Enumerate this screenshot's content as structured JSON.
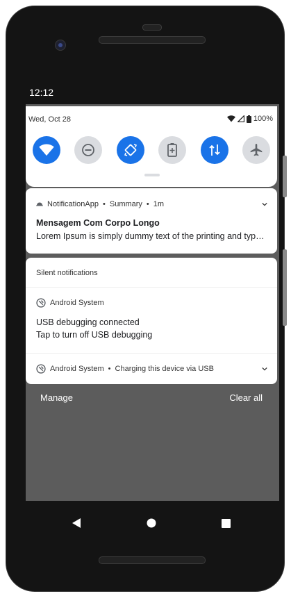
{
  "status_bar": {
    "time": "12:12"
  },
  "quick_settings": {
    "date": "Wed, Oct 28",
    "battery": "100%",
    "tiles": [
      {
        "name": "wifi",
        "icon": "wifi-icon",
        "state": "on"
      },
      {
        "name": "do-not-disturb",
        "icon": "do-not-disturb-icon",
        "state": "off"
      },
      {
        "name": "auto-rotate",
        "icon": "auto-rotate-icon",
        "state": "on"
      },
      {
        "name": "battery-saver",
        "icon": "battery-saver-icon",
        "state": "off"
      },
      {
        "name": "mobile-data",
        "icon": "mobile-data-icon",
        "state": "on"
      },
      {
        "name": "airplane-mode",
        "icon": "airplane-icon",
        "state": "off"
      }
    ]
  },
  "notification": {
    "app": "NotificationApp",
    "sub": "Summary",
    "time": "1m",
    "title": "Mensagem Com Corpo Longo",
    "text": "Lorem Ipsum is simply dummy text of the printing and typesetting industry."
  },
  "silent": {
    "header": "Silent notifications",
    "usb": {
      "app": "Android System",
      "line1": "USB debugging connected",
      "line2": "Tap to turn off USB debugging"
    },
    "charging": {
      "app": "Android System",
      "summary": "Charging this device via USB"
    }
  },
  "actions": {
    "manage": "Manage",
    "clear_all": "Clear all"
  },
  "colors": {
    "accent": "#1a73e8",
    "tile_off": "#dadce0",
    "shade": "#5c5c5c"
  }
}
